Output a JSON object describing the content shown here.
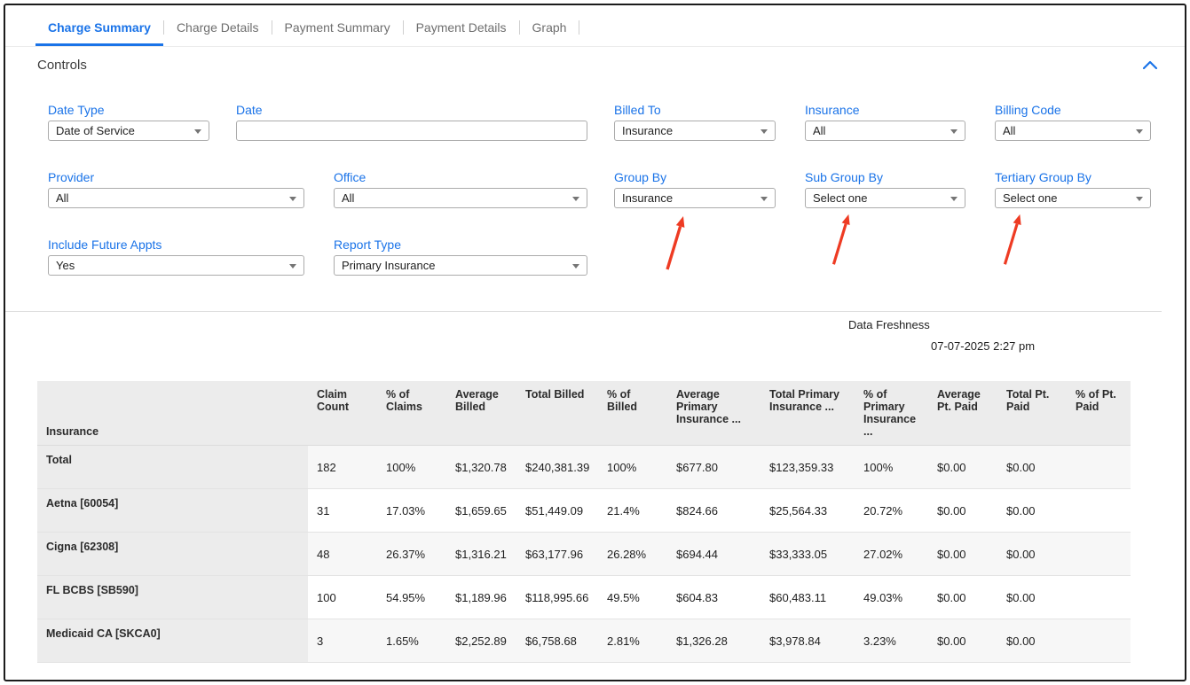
{
  "tabs": {
    "items": [
      {
        "label": "Charge Summary",
        "active": true
      },
      {
        "label": "Charge Details",
        "active": false
      },
      {
        "label": "Payment Summary",
        "active": false
      },
      {
        "label": "Payment Details",
        "active": false
      },
      {
        "label": "Graph",
        "active": false
      }
    ]
  },
  "controls": {
    "title": "Controls",
    "collapse_icon": "chevron-up-icon",
    "fields": {
      "date_type": {
        "label": "Date Type",
        "value": "Date of Service"
      },
      "date": {
        "label": "Date",
        "value": "",
        "placeholder": ""
      },
      "billed_to": {
        "label": "Billed To",
        "value": "Insurance"
      },
      "insurance": {
        "label": "Insurance",
        "value": "All"
      },
      "billing_code": {
        "label": "Billing Code",
        "value": "All"
      },
      "provider": {
        "label": "Provider",
        "value": "All"
      },
      "office": {
        "label": "Office",
        "value": "All"
      },
      "group_by": {
        "label": "Group By",
        "value": "Insurance"
      },
      "sub_group_by": {
        "label": "Sub Group By",
        "value": "Select one"
      },
      "tertiary_group_by": {
        "label": "Tertiary Group By",
        "value": "Select one"
      },
      "include_future_appts": {
        "label": "Include Future Appts",
        "value": "Yes"
      },
      "report_type": {
        "label": "Report Type",
        "value": "Primary Insurance"
      }
    }
  },
  "annotations": {
    "arrows_point_at": [
      "Group By",
      "Sub Group By",
      "Tertiary Group By"
    ]
  },
  "freshness": {
    "label": "Data Freshness",
    "timestamp": "07-07-2025 2:27 pm"
  },
  "table": {
    "columns": [
      "Insurance",
      "Claim Count",
      "% of Claims",
      "Average Billed",
      "Total Billed",
      "% of Billed",
      "Average Primary Insurance ...",
      "Total Primary Insurance ...",
      "% of Primary Insurance ...",
      "Average Pt. Paid",
      "Total Pt. Paid",
      "% of Pt. Paid"
    ],
    "rows": [
      {
        "name": "Total",
        "values": [
          "182",
          "100%",
          "$1,320.78",
          "$240,381.39",
          "100%",
          "$677.80",
          "$123,359.33",
          "100%",
          "$0.00",
          "$0.00",
          ""
        ]
      },
      {
        "name": "Aetna [60054]",
        "values": [
          "31",
          "17.03%",
          "$1,659.65",
          "$51,449.09",
          "21.4%",
          "$824.66",
          "$25,564.33",
          "20.72%",
          "$0.00",
          "$0.00",
          ""
        ]
      },
      {
        "name": "Cigna [62308]",
        "values": [
          "48",
          "26.37%",
          "$1,316.21",
          "$63,177.96",
          "26.28%",
          "$694.44",
          "$33,333.05",
          "27.02%",
          "$0.00",
          "$0.00",
          ""
        ]
      },
      {
        "name": "FL BCBS [SB590]",
        "values": [
          "100",
          "54.95%",
          "$1,189.96",
          "$118,995.66",
          "49.5%",
          "$604.83",
          "$60,483.11",
          "49.03%",
          "$0.00",
          "$0.00",
          ""
        ]
      },
      {
        "name": "Medicaid CA [SKCA0]",
        "values": [
          "3",
          "1.65%",
          "$2,252.89",
          "$6,758.68",
          "2.81%",
          "$1,326.28",
          "$3,978.84",
          "3.23%",
          "$0.00",
          "$0.00",
          ""
        ]
      }
    ]
  },
  "colors": {
    "accent_blue": "#1a73e8",
    "arrow_red": "#ee3b23",
    "header_bg": "#ececec"
  }
}
